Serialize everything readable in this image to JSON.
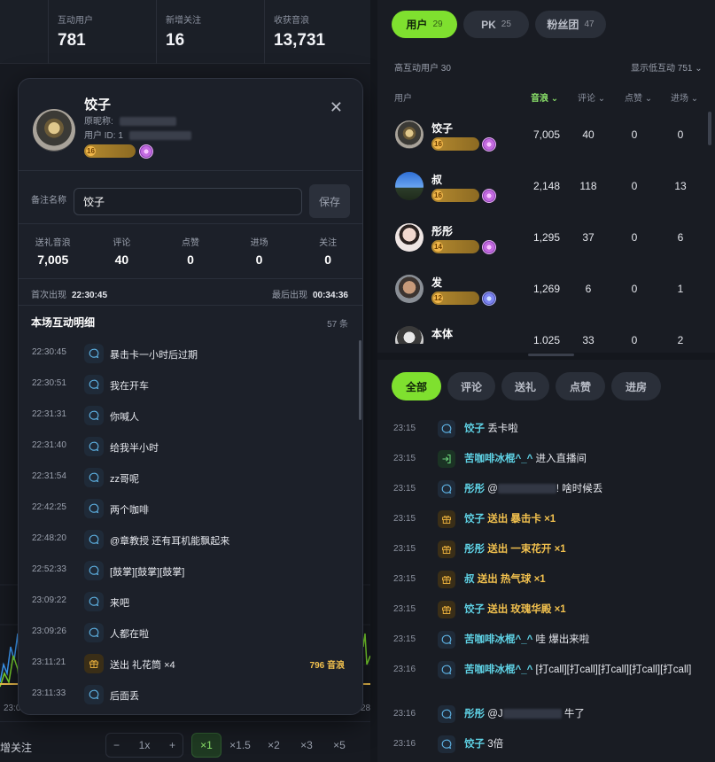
{
  "stats": [
    {
      "label": "互动用户",
      "value": "781"
    },
    {
      "label": "新增关注",
      "value": "16"
    },
    {
      "label": "收获音浪",
      "value": "13,731"
    }
  ],
  "modal": {
    "name": "饺子",
    "orig_name_label": "原昵称:",
    "user_id_label": "用户 ID: 1",
    "badge_level": "16",
    "remark_label": "备注名称",
    "remark_value": "饺子",
    "save_label": "保存",
    "stats": [
      {
        "label": "送礼音浪",
        "value": "7,005"
      },
      {
        "label": "评论",
        "value": "40"
      },
      {
        "label": "点赞",
        "value": "0"
      },
      {
        "label": "进场",
        "value": "0"
      },
      {
        "label": "关注",
        "value": "0"
      }
    ],
    "first_seen_label": "首次出现",
    "first_seen": "22:30:45",
    "last_seen_label": "最后出现",
    "last_seen": "00:34:36",
    "detail_title": "本场互动明细",
    "detail_count": "57 条",
    "details": [
      {
        "time": "22:30:45",
        "icon": "comment-icon",
        "text": "暴击卡一小时后过期",
        "amount": ""
      },
      {
        "time": "22:30:51",
        "icon": "comment-icon",
        "text": "我在开车",
        "amount": ""
      },
      {
        "time": "22:31:31",
        "icon": "comment-icon",
        "text": "你喊人",
        "amount": ""
      },
      {
        "time": "22:31:40",
        "icon": "comment-icon",
        "text": "给我半小时",
        "amount": ""
      },
      {
        "time": "22:31:54",
        "icon": "comment-icon",
        "text": "zz哥呢",
        "amount": ""
      },
      {
        "time": "22:42:25",
        "icon": "comment-icon",
        "text": "两个咖啡",
        "amount": ""
      },
      {
        "time": "22:48:20",
        "icon": "comment-icon",
        "text": "@章教授 还有耳机能飘起来",
        "amount": ""
      },
      {
        "time": "22:52:33",
        "icon": "comment-icon",
        "text": "[鼓掌][鼓掌][鼓掌]",
        "amount": ""
      },
      {
        "time": "23:09:22",
        "icon": "comment-icon",
        "text": "来吧",
        "amount": ""
      },
      {
        "time": "23:09:26",
        "icon": "comment-icon",
        "text": "人都在啦",
        "amount": ""
      },
      {
        "time": "23:11:21",
        "icon": "gift-icon",
        "text": "送出 礼花筒 ×4",
        "amount": "796 音浪"
      },
      {
        "time": "23:11:33",
        "icon": "comment-icon",
        "text": "后面丢",
        "amount": ""
      }
    ]
  },
  "bottom": {
    "label": "增关注",
    "stepper_value": "1x",
    "speeds": [
      "×1",
      "×1.5",
      "×2",
      "×3",
      "×5"
    ],
    "x_ticks": [
      "23:0",
      "28"
    ]
  },
  "right": {
    "tabs": [
      {
        "label": "用户",
        "count": "29"
      },
      {
        "label": "PK",
        "count": "25"
      },
      {
        "label": "粉丝团",
        "count": "47"
      }
    ],
    "high_users": "高互动用户 30",
    "show_low": "显示低互动 751",
    "columns": [
      "用户",
      "音浪",
      "评论",
      "点赞",
      "进场"
    ],
    "users": [
      {
        "name": "饺子",
        "level": "16",
        "gift": "7,005",
        "comment": "40",
        "like": "0",
        "enter": "0"
      },
      {
        "name": "叔",
        "level": "16",
        "gift": "2,148",
        "comment": "118",
        "like": "0",
        "enter": "13"
      },
      {
        "name": "彤彤",
        "level": "14",
        "gift": "1,295",
        "comment": "37",
        "like": "0",
        "enter": "6"
      },
      {
        "name": "发",
        "level": "12",
        "gift": "1,269",
        "comment": "6",
        "like": "0",
        "enter": "1"
      },
      {
        "name": "本体",
        "level": "",
        "gift": "1,025",
        "comment": "33",
        "like": "0",
        "enter": "2"
      }
    ],
    "filters": [
      "全部",
      "评论",
      "送礼",
      "点赞",
      "进房"
    ],
    "feed": [
      {
        "time": "23:15",
        "icon": "comment-icon",
        "name": "饺子",
        "action": "",
        "text": "丢卡啦"
      },
      {
        "time": "23:15",
        "icon": "enter-icon",
        "name": "苦咖啡冰棍^_^",
        "action": "",
        "text": "进入直播间"
      },
      {
        "time": "23:15",
        "icon": "comment-icon",
        "name": "彤彤",
        "action": "",
        "text": "@",
        "text2": "! 啥时候丢"
      },
      {
        "time": "23:15",
        "icon": "gift-icon",
        "name": "饺子",
        "action": "送出 暴击卡 ×1",
        "text": ""
      },
      {
        "time": "23:15",
        "icon": "gift-icon",
        "name": "彤彤",
        "action": "送出 一束花开 ×1",
        "text": ""
      },
      {
        "time": "23:15",
        "icon": "gift-icon",
        "name": "叔",
        "action": "送出 热气球 ×1",
        "text": ""
      },
      {
        "time": "23:15",
        "icon": "gift-icon",
        "name": "饺子",
        "action": "送出 玫瑰华殿 ×1",
        "text": ""
      },
      {
        "time": "23:15",
        "icon": "comment-icon",
        "name": "苦咖啡冰棍^_^",
        "action": "",
        "text": "哇 爆出来啦"
      },
      {
        "time": "23:16",
        "icon": "comment-icon",
        "name": "苦咖啡冰棍^_^",
        "action": "",
        "text": "[打call][打call][打call][打call][打call]"
      },
      {
        "time": "23:16",
        "icon": "comment-icon",
        "name": "彤彤",
        "action": "",
        "text": "@J",
        "text2": " 牛了"
      },
      {
        "time": "23:16",
        "icon": "comment-icon",
        "name": "饺子",
        "action": "",
        "text": "3倍"
      }
    ]
  }
}
